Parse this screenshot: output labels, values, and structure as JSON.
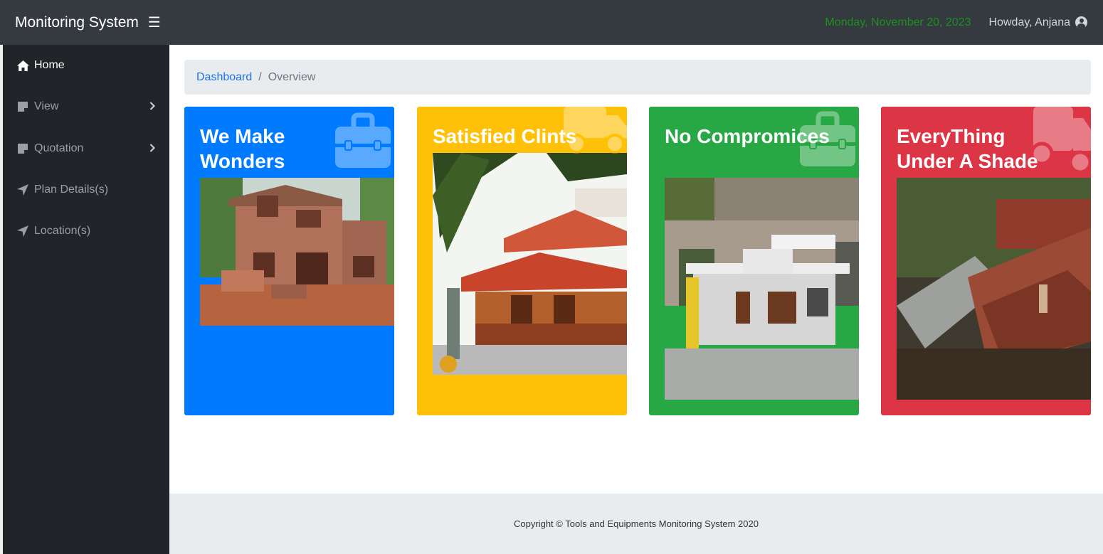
{
  "header": {
    "brand": "Monitoring System",
    "date": "Monday, November 20, 2023",
    "greeting": "Howday, Anjana"
  },
  "sidebar": {
    "items": [
      {
        "label": "Home",
        "icon": "home-icon",
        "active": true,
        "has_submenu": false
      },
      {
        "label": "View",
        "icon": "note-icon",
        "active": false,
        "has_submenu": true
      },
      {
        "label": "Quotation",
        "icon": "note-icon",
        "active": false,
        "has_submenu": true
      },
      {
        "label": "Plan Details(s)",
        "icon": "location-arrow-icon",
        "active": false,
        "has_submenu": false
      },
      {
        "label": "Location(s)",
        "icon": "location-arrow-icon",
        "active": false,
        "has_submenu": false
      }
    ]
  },
  "breadcrumb": {
    "link": "Dashboard",
    "separator": "/",
    "current": "Overview"
  },
  "cards": [
    {
      "title": "We Make Wonders",
      "color": "#007bff",
      "icon": "toolbox-icon",
      "image": "house-under-construction"
    },
    {
      "title": "Satisfied Clints",
      "color": "#ffc107",
      "icon": "truck-icon",
      "image": "traditional-house-red-roof"
    },
    {
      "title": "No Compromices",
      "color": "#28a745",
      "icon": "toolbox-icon",
      "image": "modern-white-house"
    },
    {
      "title": "EveryThing Under A Shade",
      "color": "#dc3545",
      "icon": "truck-icon",
      "image": "brick-construction-site"
    }
  ],
  "footer": {
    "text": "Copyright © Tools and Equipments Monitoring System 2020"
  },
  "colors": {
    "topbar": "#343a40",
    "sidebar": "#212529",
    "link": "#1a73e8",
    "date": "#1f8f1f"
  }
}
